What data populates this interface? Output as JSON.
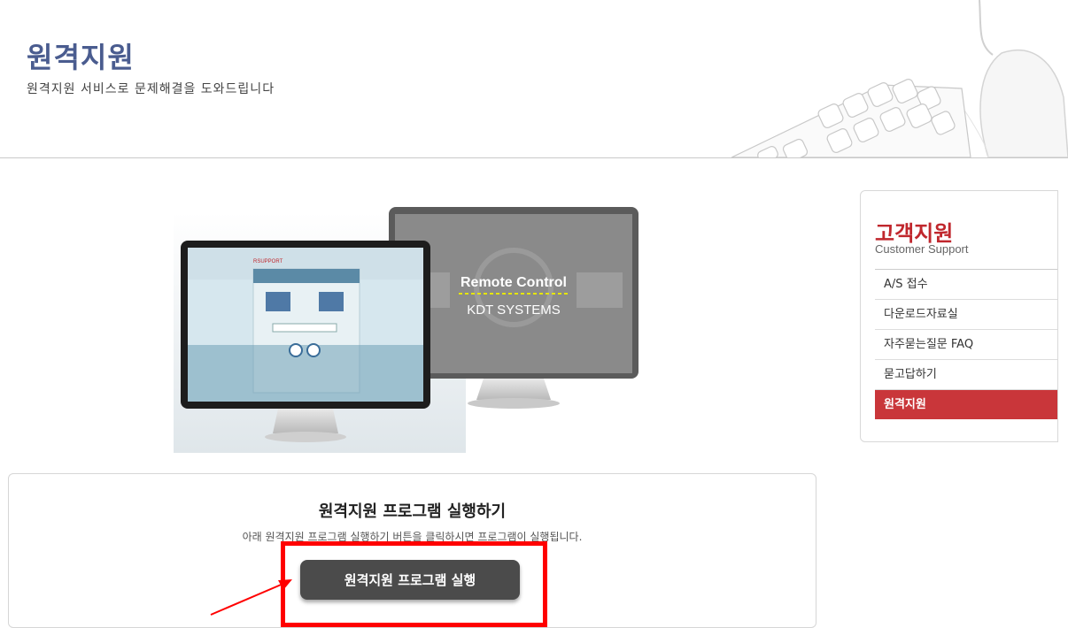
{
  "header": {
    "title": "원격지원",
    "subtitle": "원격지원 서비스로 문제해결을 도와드립니다"
  },
  "hero": {
    "brand": "RSUPPORT",
    "screen_title": "Remote Control",
    "screen_subtitle": "KDT SYSTEMS"
  },
  "sidebar": {
    "title": "고객지원",
    "subtitle": "Customer Support",
    "items": [
      {
        "label": "A/S 접수"
      },
      {
        "label": "다운로드자료실"
      },
      {
        "label": "자주묻는질문 FAQ"
      },
      {
        "label": "묻고답하기"
      },
      {
        "label": "원격지원"
      }
    ],
    "active_index": 4
  },
  "run_section": {
    "title": "원격지원 프로그램 실행하기",
    "description": "아래 원격지원 프로그램 실행하기 버튼을 클릭하시면 프로그램이 실행됩니다.",
    "button_label": "원격지원 프로그램 실행"
  },
  "colors": {
    "title_blue": "#4a5c8f",
    "accent_red": "#c9363a",
    "button_dark": "#4b4b4b",
    "highlight": "#ff0000"
  }
}
